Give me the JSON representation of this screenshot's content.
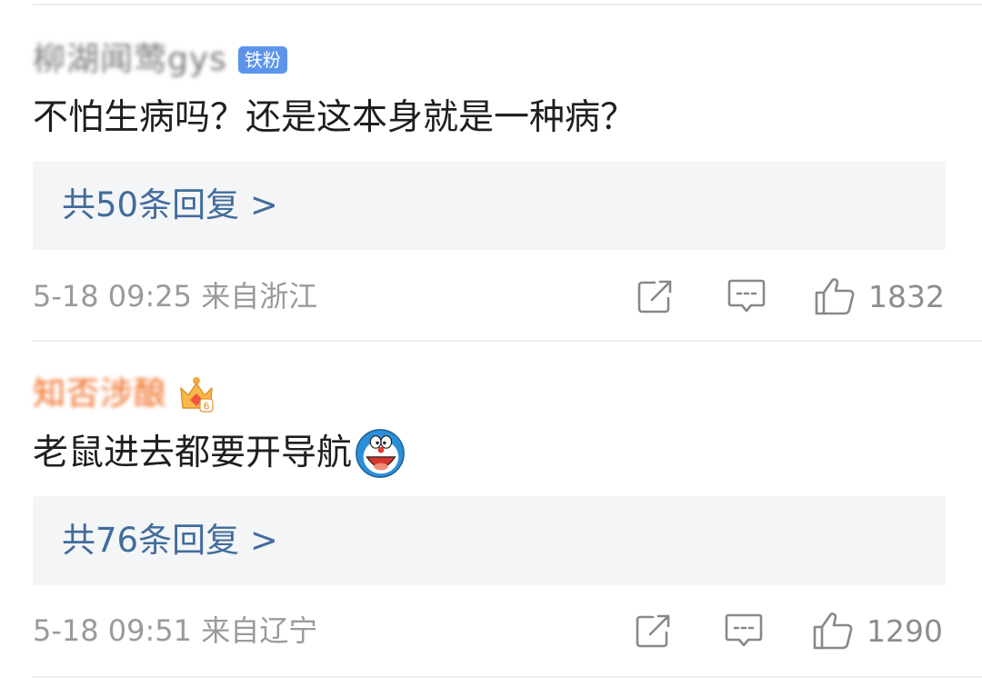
{
  "comments": [
    {
      "username": "柳湖闻莺gys",
      "badge": "铁粉",
      "text": "不怕生病吗？还是这本身就是一种病？",
      "replies_label": "共50条回复 >",
      "timestamp": "5-18 09:25 来自浙江",
      "likes": "1832"
    },
    {
      "username": "知否涉酿",
      "badge_icon": "crown-badge-icon",
      "text": "老鼠进去都要开导航",
      "emoji": "doraemon-emoji",
      "replies_label": "共76条回复 >",
      "timestamp": "5-18 09:51 来自辽宁",
      "likes": "1290"
    }
  ],
  "colors": {
    "reply_link": "#426c9c",
    "fan_badge": "#5b94ea",
    "username_vip": "#f06b1f",
    "meta_text": "#9a9a9a",
    "reply_box_bg": "#f4f5f7"
  }
}
